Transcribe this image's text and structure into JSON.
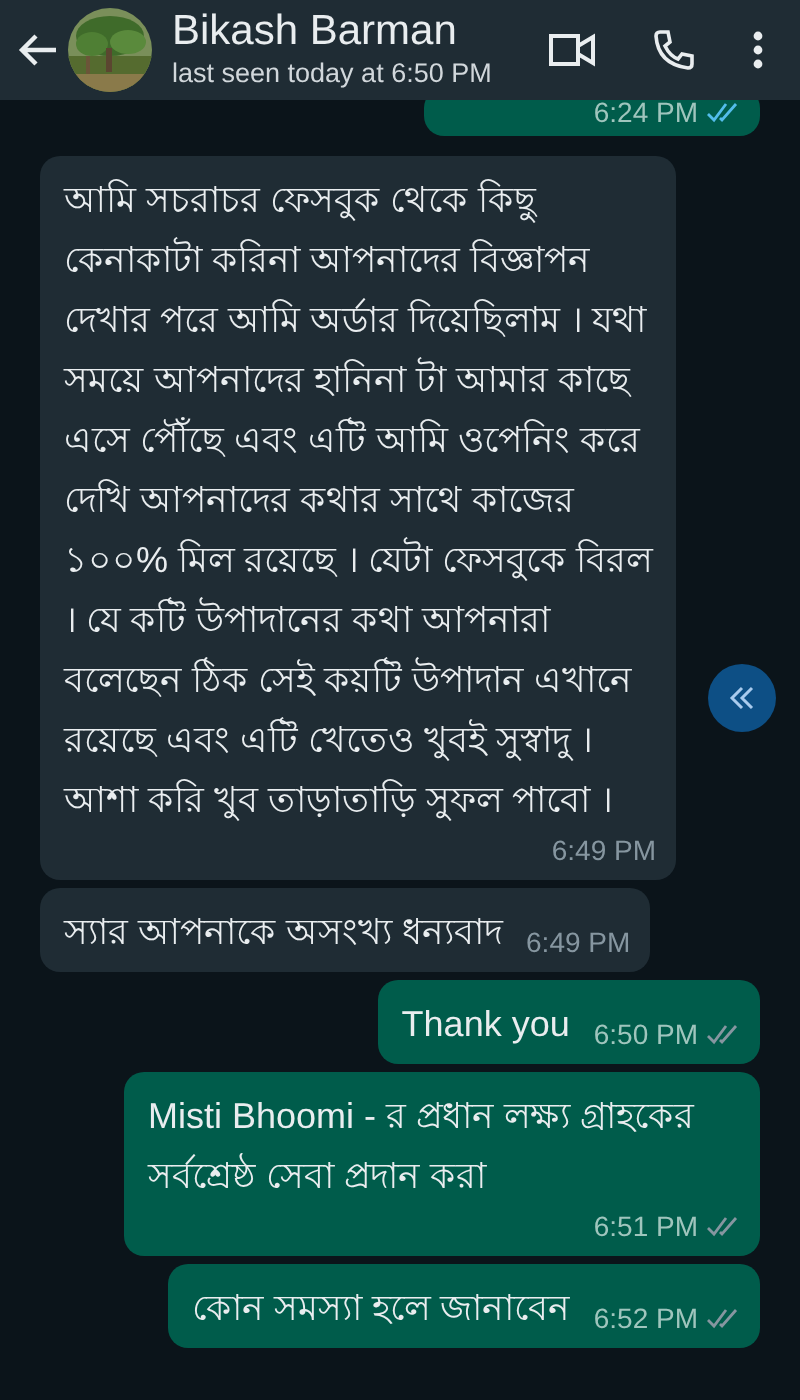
{
  "header": {
    "name": "Bikash Barman",
    "status": "last seen today at 6:50 PM"
  },
  "messages": [
    {
      "kind": "outgoing",
      "time": "6:24 PM",
      "read": true
    },
    {
      "kind": "incoming",
      "text": "আমি সচরাচর ফেসবুক থেকে কিছু কেনাকাটা করিনা আপনাদের বিজ্ঞাপন দেখার পরে আমি অর্ডার দিয়েছিলাম । যথা সময়ে আপনাদের হানিনা টা আমার কাছে এসে পৌঁছে এবং এটি আমি ওপেনিং করে দেখি আপনাদের কথার সাথে কাজের ১০০% মিল রয়েছে । যেটা ফেসবুকে বিরল । যে কটি উপাদানের কথা আপনারা বলেছেন ঠিক সেই কয়টি উপাদান এখানে রয়েছে এবং এটি খেতেও খুবই সুস্বাদু । আশা করি খুব তাড়াতাড়ি সুফল পাবো ।",
      "time": "6:49 PM"
    },
    {
      "kind": "incoming",
      "text": "স্যার আপনাকে অসংখ্য ধন্যবাদ",
      "time": "6:49 PM"
    },
    {
      "kind": "outgoing",
      "text": "Thank you",
      "time": "6:50 PM",
      "read": false
    },
    {
      "kind": "outgoing",
      "text": "Misti Bhoomi - র প্রধান লক্ষ্য গ্রাহকের সর্বশ্রেষ্ঠ সেবা প্রদান করা",
      "time": "6:51 PM",
      "read": false
    },
    {
      "kind": "outgoing",
      "text": "কোন সমস্যা হলে জানাবেন",
      "time": "6:52 PM",
      "read": false
    }
  ]
}
